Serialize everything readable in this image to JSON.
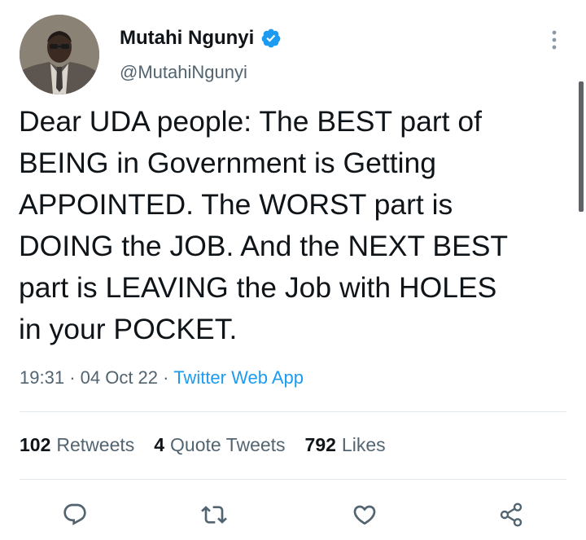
{
  "author": {
    "display_name": "Mutahi Ngunyi",
    "handle": "@MutahiNgunyi",
    "verified": true
  },
  "tweet": {
    "lines": [
      "Dear UDA people: The BEST part of",
      "BEING in Government is Getting",
      "APPOINTED. The WORST part is",
      "DOING the JOB. And the NEXT BEST",
      "part is LEAVING the Job with HOLES",
      "in your POCKET."
    ]
  },
  "meta": {
    "time": "19:31",
    "separator": "·",
    "date": "04 Oct 22",
    "source": "Twitter Web App"
  },
  "stats": {
    "retweets_count": "102",
    "retweets_label": "Retweets",
    "quotes_count": "4",
    "quotes_label": "Quote Tweets",
    "likes_count": "792",
    "likes_label": "Likes"
  },
  "icons": {
    "more": "more-vertical-icon",
    "verified": "verified-badge-icon",
    "reply": "reply-icon",
    "retweet": "retweet-icon",
    "like": "heart-icon",
    "share": "share-icon"
  },
  "colors": {
    "text": "#0f1419",
    "secondary": "#536471",
    "accent": "#1d9bf0"
  }
}
